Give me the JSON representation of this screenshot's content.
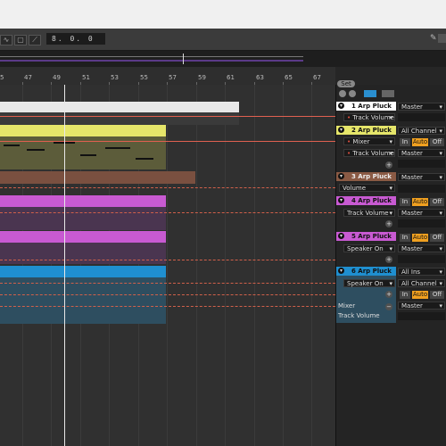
{
  "transport": {
    "tempo_field": "8. 0. 0"
  },
  "ruler": {
    "bars": [
      "5",
      "47",
      "49",
      "51",
      "53",
      "55",
      "57",
      "59",
      "61",
      "63",
      "65",
      "67"
    ]
  },
  "session": {
    "set_label": "Set"
  },
  "tracks": [
    {
      "id": 1,
      "title": "1 Arp Pluck",
      "color": "#ffffff",
      "param": "Track Volume",
      "output": "Master"
    },
    {
      "id": 2,
      "title": "2 Arp Pluck",
      "color": "#e6e66a",
      "device": "Mixer",
      "param": "Track Volume",
      "input": "All Channel",
      "mon_in": "In",
      "mon_auto": "Auto",
      "mon_off": "Off",
      "output": "Master"
    },
    {
      "id": 3,
      "title": "3 Arp Pluck",
      "color": "#8a5a44",
      "param": "Volume",
      "output": "Master"
    },
    {
      "id": 4,
      "title": "4 Arp Pluck",
      "color": "#c85ad2",
      "param": "Track Volume",
      "mon_in": "In",
      "mon_auto": "Auto",
      "mon_off": "Off",
      "output": "Master"
    },
    {
      "id": 5,
      "title": "5 Arp Pluck",
      "color": "#c85ad2",
      "param": "Speaker On",
      "mon_in": "In",
      "mon_auto": "Auto",
      "mon_off": "Off",
      "output": "Master"
    },
    {
      "id": 6,
      "title": "6 Arp Pluck",
      "color": "#1f8fd0",
      "input_ins": "All Ins",
      "param": "Speaker On",
      "input": "All Channel",
      "mon_in": "In",
      "mon_auto": "Auto",
      "mon_off": "Off",
      "device": "Mixer",
      "param2": "Track Volume",
      "output": "Master"
    }
  ]
}
